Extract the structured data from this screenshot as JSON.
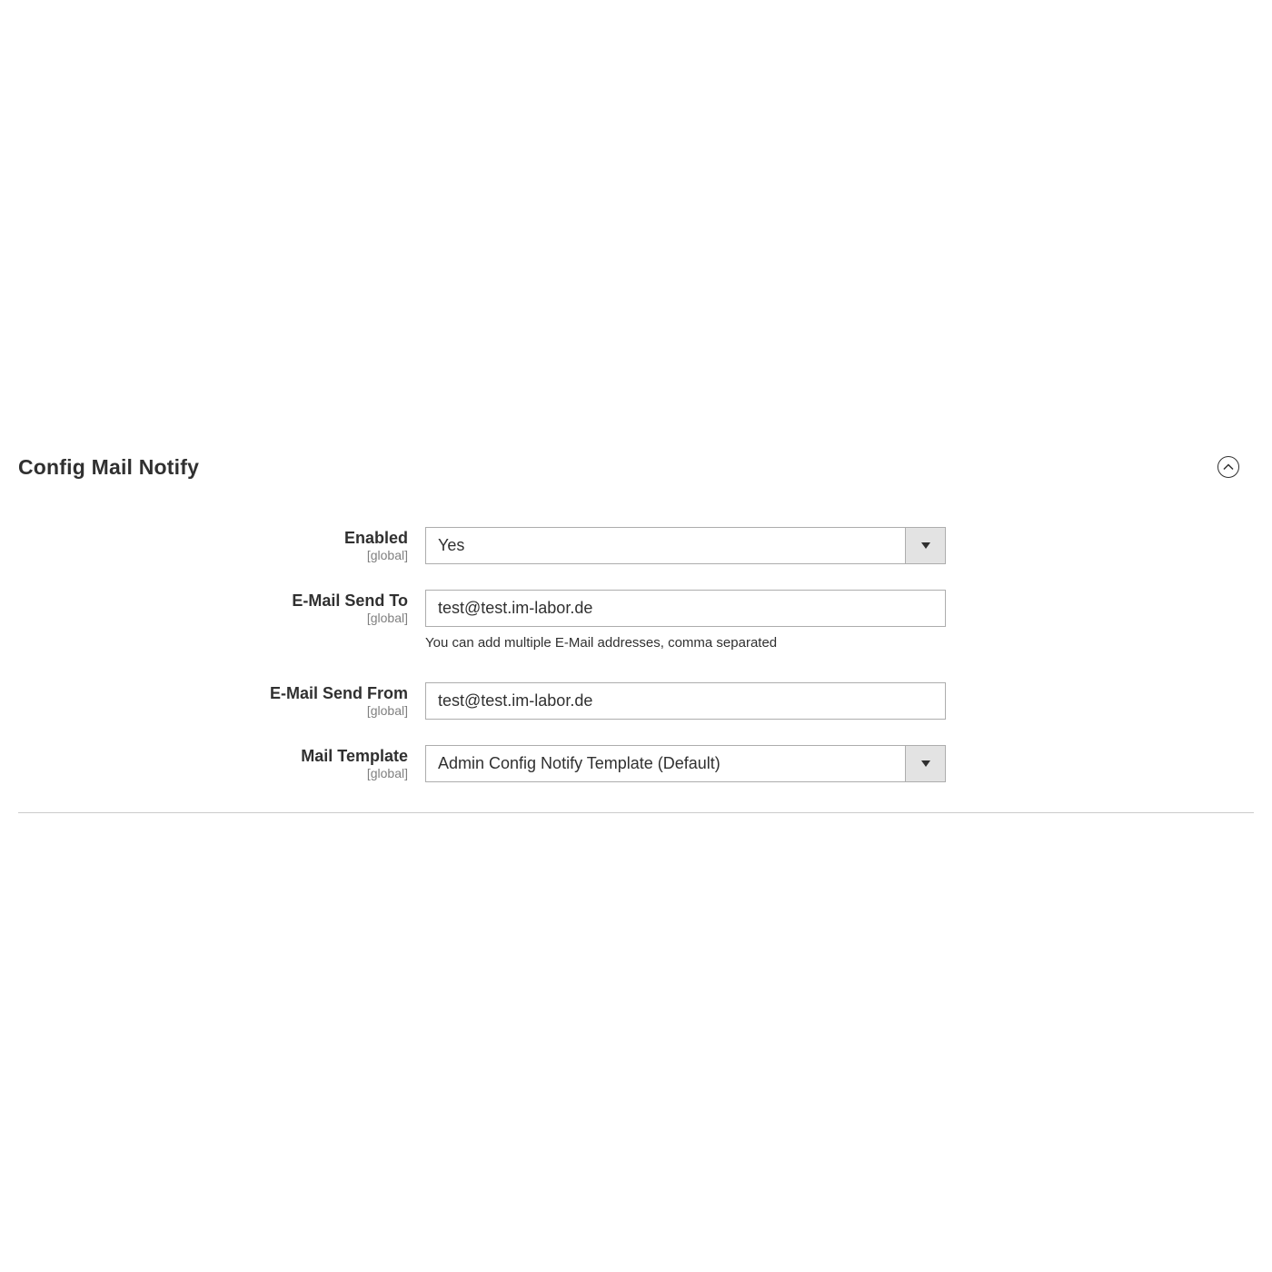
{
  "section": {
    "title": "Config Mail Notify",
    "toggle_icon": "chevron-up-circle-icon"
  },
  "fields": {
    "enabled": {
      "label": "Enabled",
      "scope": "[global]",
      "value": "Yes"
    },
    "send_to": {
      "label": "E-Mail Send To",
      "scope": "[global]",
      "value": "test@test.im-labor.de",
      "note": "You can add multiple E-Mail addresses, comma separated"
    },
    "send_from": {
      "label": "E-Mail Send From",
      "scope": "[global]",
      "value": "test@test.im-labor.de"
    },
    "mail_template": {
      "label": "Mail Template",
      "scope": "[global]",
      "value": "Admin Config Notify Template (Default)"
    }
  },
  "colors": {
    "text": "#303030",
    "scope": "#808080",
    "border": "#adadad",
    "select_button": "#e3e3e3",
    "divider": "#cccccc"
  }
}
